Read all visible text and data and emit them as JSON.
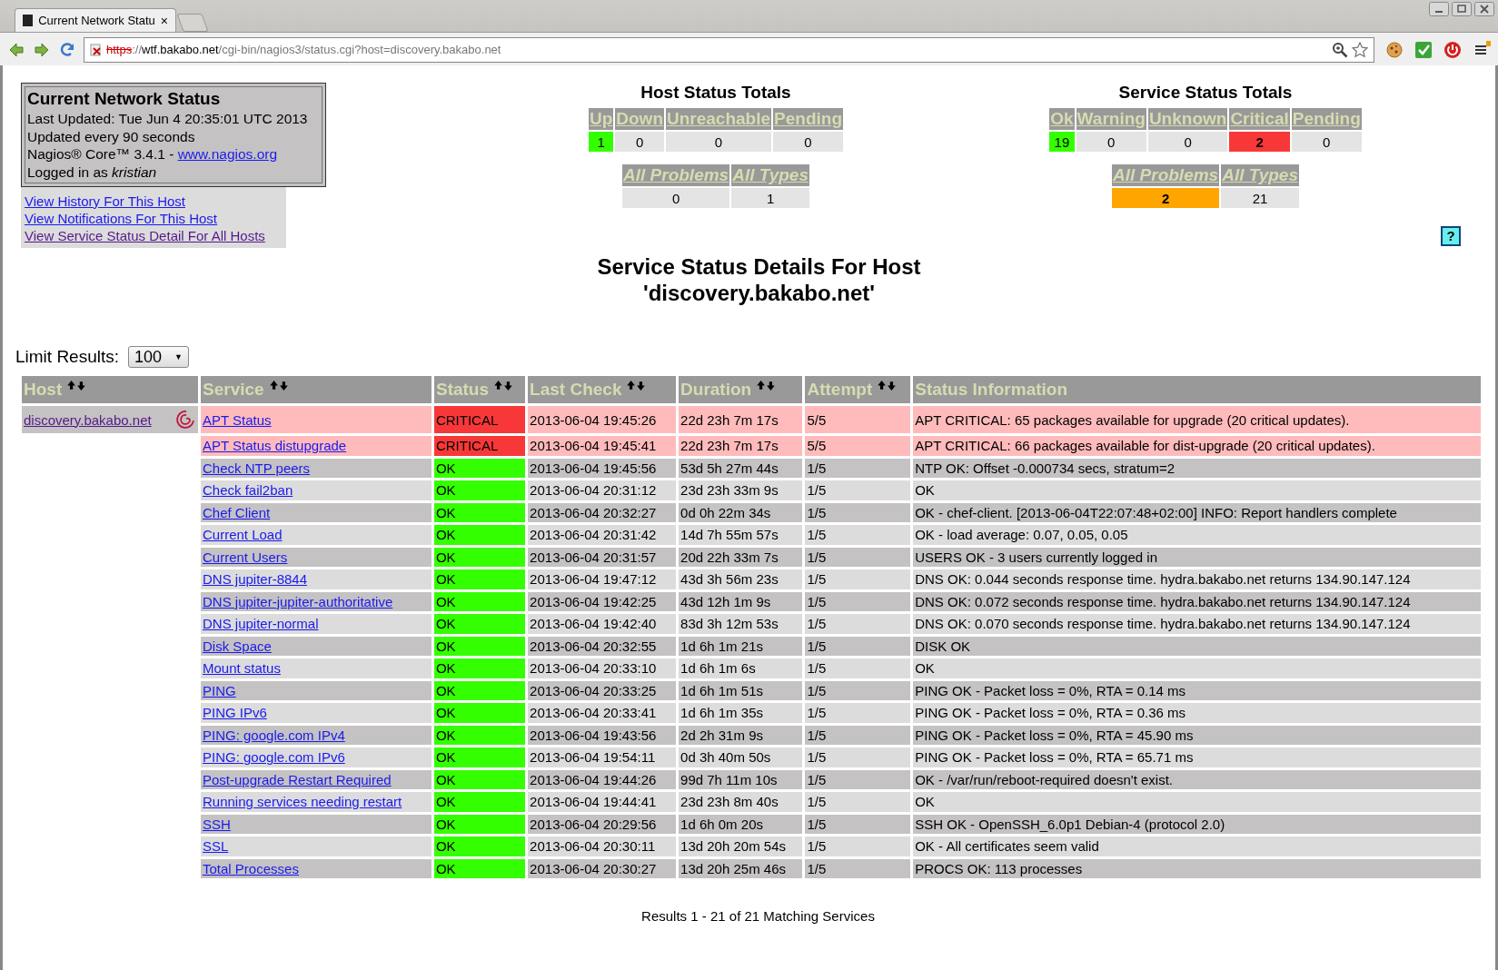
{
  "browser": {
    "tab": {
      "title": "Current Network Statu",
      "close": "×"
    },
    "url": [
      {
        "text": "https",
        "kind": "insecure"
      },
      {
        "text": "://",
        "kind": "plain"
      },
      {
        "text": "wtf.bakabo.net",
        "kind": "domain"
      },
      {
        "text": "/cgi-bin/nagios3/status.cgi?host=discovery.bakabo.net",
        "kind": "plain"
      }
    ]
  },
  "info_box": {
    "title": "Current Network Status",
    "last_updated": "Last Updated: Tue Jun 4 20:35:01 UTC 2013",
    "interval": "Updated every 90 seconds",
    "version": "Nagios® Core™ 3.4.1 - ",
    "version_link": "www.nagios.org",
    "login": "Logged in as *kristian*"
  },
  "links": [
    {
      "label": "View History For This Host",
      "visited": false
    },
    {
      "label": "View Notifications For This Host",
      "visited": false
    },
    {
      "label": "View Service Status Detail For All Hosts",
      "visited": true
    }
  ],
  "host_totals": {
    "title": "Host Status Totals",
    "cells": [
      {
        "label": "Up",
        "value": "1",
        "kind": "ok"
      },
      {
        "label": "Down",
        "value": "0",
        "kind": "none"
      },
      {
        "label": "Unreachable",
        "value": "0",
        "kind": "none"
      },
      {
        "label": "Pending",
        "value": "0",
        "kind": "none"
      }
    ],
    "summary": [
      {
        "label": "All Problems",
        "value": "0",
        "kind": "none"
      },
      {
        "label": "All Types",
        "value": "1",
        "kind": "none"
      }
    ]
  },
  "service_totals": {
    "title": "Service Status Totals",
    "cells": [
      {
        "label": "Ok",
        "value": "19",
        "kind": "ok"
      },
      {
        "label": "Warning",
        "value": "0",
        "kind": "none"
      },
      {
        "label": "Unknown",
        "value": "0",
        "kind": "none"
      },
      {
        "label": "Critical",
        "value": "2",
        "kind": "critical"
      },
      {
        "label": "Pending",
        "value": "0",
        "kind": "none"
      }
    ],
    "summary": [
      {
        "label": "All Problems",
        "value": "2",
        "kind": "problem"
      },
      {
        "label": "All Types",
        "value": "21",
        "kind": "none"
      }
    ]
  },
  "help": "?",
  "title": "Service Status Details For Host",
  "host_title": "'discovery.bakabo.net'",
  "limit": {
    "label": "Limit Results:",
    "value": "100",
    "caret": "▼"
  },
  "table": {
    "columns": [
      {
        "label": "Host",
        "sortable": true
      },
      {
        "label": "Service",
        "sortable": true
      },
      {
        "label": "Status",
        "sortable": true
      },
      {
        "label": "Last Check",
        "sortable": true
      },
      {
        "label": "Duration",
        "sortable": true
      },
      {
        "label": "Attempt",
        "sortable": true
      },
      {
        "label": "Status Information",
        "sortable": false
      }
    ],
    "rows": [
      {
        "host": "discovery.bakabo.net",
        "service": "APT Status",
        "status": "CRITICAL",
        "kind": "critical",
        "last_check": "2013-06-04 19:45:26",
        "duration": "22d 23h 7m 17s",
        "attempt": "5/5",
        "info": "APT CRITICAL: 65 packages available for upgrade (20 critical updates)."
      },
      {
        "service": "APT Status distupgrade",
        "status": "CRITICAL",
        "kind": "critical",
        "last_check": "2013-06-04 19:45:41",
        "duration": "22d 23h 7m 17s",
        "attempt": "5/5",
        "info": "APT CRITICAL: 66 packages available for dist-upgrade (20 critical updates)."
      },
      {
        "service": "Check NTP peers",
        "status": "OK",
        "kind": "ok",
        "last_check": "2013-06-04 19:45:56",
        "duration": "53d 5h 27m 44s",
        "attempt": "1/5",
        "info": "NTP OK: Offset -0.000734 secs, stratum=2"
      },
      {
        "service": "Check fail2ban",
        "status": "OK",
        "kind": "ok",
        "last_check": "2013-06-04 20:31:12",
        "duration": "23d 23h 33m 9s",
        "attempt": "1/5",
        "info": "OK"
      },
      {
        "service": "Chef Client",
        "status": "OK",
        "kind": "ok",
        "last_check": "2013-06-04 20:32:27",
        "duration": "0d 0h 22m 34s",
        "attempt": "1/5",
        "info": "OK - chef-client. [2013-06-04T22:07:48+02:00] INFO: Report handlers complete"
      },
      {
        "service": "Current Load",
        "status": "OK",
        "kind": "ok",
        "last_check": "2013-06-04 20:31:42",
        "duration": "14d 7h 55m 57s",
        "attempt": "1/5",
        "info": "OK - load average: 0.07, 0.05, 0.05"
      },
      {
        "service": "Current Users",
        "status": "OK",
        "kind": "ok",
        "last_check": "2013-06-04 20:31:57",
        "duration": "20d 22h 33m 7s",
        "attempt": "1/5",
        "info": "USERS OK - 3 users currently logged in"
      },
      {
        "service": "DNS jupiter-8844",
        "status": "OK",
        "kind": "ok",
        "last_check": "2013-06-04 19:47:12",
        "duration": "43d 3h 56m 23s",
        "attempt": "1/5",
        "info": "DNS OK: 0.044 seconds response time. hydra.bakabo.net returns 134.90.147.124"
      },
      {
        "service": "DNS jupiter-jupiter-authoritative",
        "status": "OK",
        "kind": "ok",
        "last_check": "2013-06-04 19:42:25",
        "duration": "43d 12h 1m 9s",
        "attempt": "1/5",
        "info": "DNS OK: 0.072 seconds response time. hydra.bakabo.net returns 134.90.147.124"
      },
      {
        "service": "DNS jupiter-normal",
        "status": "OK",
        "kind": "ok",
        "last_check": "2013-06-04 19:42:40",
        "duration": "83d 3h 12m 53s",
        "attempt": "1/5",
        "info": "DNS OK: 0.070 seconds response time. hydra.bakabo.net returns 134.90.147.124"
      },
      {
        "service": "Disk Space",
        "status": "OK",
        "kind": "ok",
        "last_check": "2013-06-04 20:32:55",
        "duration": "1d 6h 1m 21s",
        "attempt": "1/5",
        "info": "DISK OK"
      },
      {
        "service": "Mount status",
        "status": "OK",
        "kind": "ok",
        "last_check": "2013-06-04 20:33:10",
        "duration": "1d 6h 1m 6s",
        "attempt": "1/5",
        "info": "OK"
      },
      {
        "service": "PING",
        "status": "OK",
        "kind": "ok",
        "last_check": "2013-06-04 20:33:25",
        "duration": "1d 6h 1m 51s",
        "attempt": "1/5",
        "info": "PING OK - Packet loss = 0%, RTA = 0.14 ms"
      },
      {
        "service": "PING IPv6",
        "status": "OK",
        "kind": "ok",
        "last_check": "2013-06-04 20:33:41",
        "duration": "1d 6h 1m 35s",
        "attempt": "1/5",
        "info": "PING OK - Packet loss = 0%, RTA = 0.36 ms"
      },
      {
        "service": "PING: google.com IPv4",
        "status": "OK",
        "kind": "ok",
        "last_check": "2013-06-04 19:43:56",
        "duration": "2d 2h 31m 9s",
        "attempt": "1/5",
        "info": "PING OK - Packet loss = 0%, RTA = 45.90 ms"
      },
      {
        "service": "PING: google.com IPv6",
        "status": "OK",
        "kind": "ok",
        "last_check": "2013-06-04 19:54:11",
        "duration": "0d 3h 40m 50s",
        "attempt": "1/5",
        "info": "PING OK - Packet loss = 0%, RTA = 65.71 ms"
      },
      {
        "service": "Post-upgrade Restart Required",
        "status": "OK",
        "kind": "ok",
        "last_check": "2013-06-04 19:44:26",
        "duration": "99d 7h 11m 10s",
        "attempt": "1/5",
        "info": "OK - /var/run/reboot-required doesn't exist."
      },
      {
        "service": "Running services needing restart",
        "status": "OK",
        "kind": "ok",
        "last_check": "2013-06-04 19:44:41",
        "duration": "23d 23h 8m 40s",
        "attempt": "1/5",
        "info": "OK"
      },
      {
        "service": "SSH",
        "status": "OK",
        "kind": "ok",
        "last_check": "2013-06-04 20:29:56",
        "duration": "1d 6h 0m 20s",
        "attempt": "1/5",
        "info": "SSH OK - OpenSSH_6.0p1 Debian-4 (protocol 2.0)"
      },
      {
        "service": "SSL",
        "status": "OK",
        "kind": "ok",
        "last_check": "2013-06-04 20:30:11",
        "duration": "13d 20h 20m 54s",
        "attempt": "1/5",
        "info": "OK - All certificates seem valid"
      },
      {
        "service": "Total Processes",
        "status": "OK",
        "kind": "ok",
        "last_check": "2013-06-04 20:30:27",
        "duration": "13d 20h 25m 46s",
        "attempt": "1/5",
        "info": "PROCS OK: 113 processes"
      }
    ]
  },
  "footer": "Results 1 - 21 of 21 Matching Services"
}
